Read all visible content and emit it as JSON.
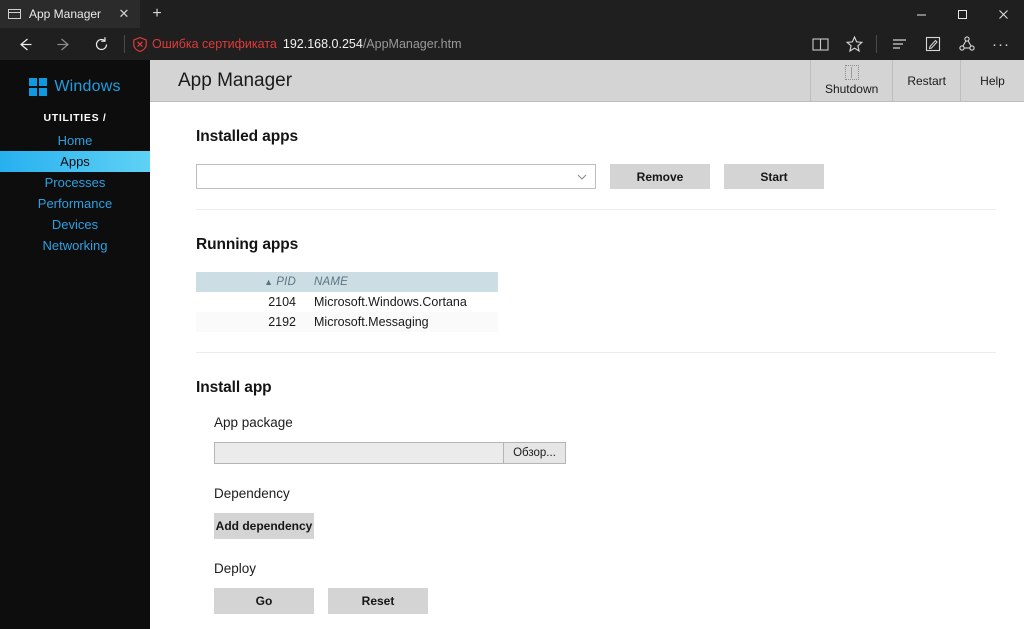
{
  "browser": {
    "tab": {
      "title": "App Manager",
      "icon": "page-icon",
      "close_label": "✕"
    },
    "new_tab_label": "+",
    "window_controls": {
      "minimize": "minimize",
      "maximize": "maximize",
      "close": "close"
    },
    "nav": {
      "back": "back-arrow",
      "forward": "forward-arrow",
      "refresh": "refresh-arrow"
    },
    "address": {
      "certificate_error": "Ошибка сертификата",
      "url_host": "192.168.0.254",
      "url_path": "/AppManager.htm",
      "error_color": "#e03a3a"
    },
    "toolbar": {
      "reading_view": "reading-view-icon",
      "favorites": "star-icon",
      "hub": "hub-icon",
      "web_note": "web-note-icon",
      "share": "share-icon",
      "more": "···"
    }
  },
  "sidebar": {
    "brand": "Windows",
    "breadcrumb": "UTILITIES /",
    "accent_color": "#2f9fe0",
    "active_highlight": "#27b0ef",
    "items": [
      {
        "label": "Home",
        "active": false
      },
      {
        "label": "Apps",
        "active": true
      },
      {
        "label": "Processes",
        "active": false
      },
      {
        "label": "Performance",
        "active": false
      },
      {
        "label": "Devices",
        "active": false
      },
      {
        "label": "Networking",
        "active": false
      }
    ]
  },
  "header": {
    "title": "App Manager",
    "actions": [
      {
        "label": "Shutdown",
        "icon": "broken-image-icon"
      },
      {
        "label": "Restart",
        "icon": ""
      },
      {
        "label": "Help",
        "icon": ""
      }
    ]
  },
  "installed_apps": {
    "title": "Installed apps",
    "select_value": "",
    "select_icon": "chevron-down-icon",
    "remove_label": "Remove",
    "start_label": "Start"
  },
  "running_apps": {
    "title": "Running apps",
    "columns": [
      "",
      "PID",
      "NAME"
    ],
    "sort_column": "PID",
    "sort_caret": "▲",
    "rows": [
      {
        "select": "",
        "pid": "2104",
        "name": "Microsoft.Windows.Cortana"
      },
      {
        "select": "",
        "pid": "2192",
        "name": "Microsoft.Messaging"
      }
    ]
  },
  "install_app": {
    "title": "Install app",
    "app_package_label": "App package",
    "app_package_value": "",
    "browse_label": "Обзор...",
    "dependency_label": "Dependency",
    "add_dependency_label": "Add dependency",
    "deploy_label": "Deploy",
    "go_label": "Go",
    "reset_label": "Reset"
  }
}
